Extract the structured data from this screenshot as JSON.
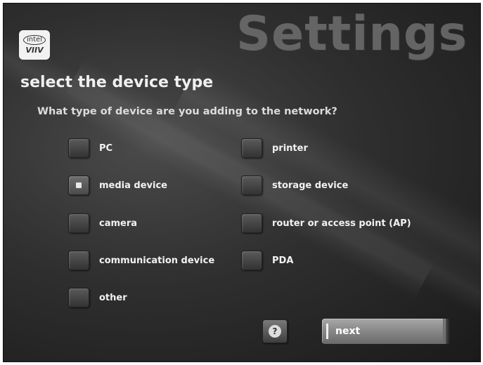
{
  "header": {
    "watermark_title": "Settings",
    "logo": {
      "brand_text": "intel",
      "product_text": "VIIV"
    }
  },
  "main": {
    "title": "select the device type",
    "question": "What type of device are you adding to the network?",
    "options_left": [
      {
        "label": "PC",
        "checked": false
      },
      {
        "label": "media device",
        "checked": true
      },
      {
        "label": "camera",
        "checked": false
      },
      {
        "label": "communication device",
        "checked": false
      },
      {
        "label": "other",
        "checked": false
      }
    ],
    "options_right": [
      {
        "label": "printer",
        "checked": false
      },
      {
        "label": "storage device",
        "checked": false
      },
      {
        "label": "router or access point (AP)",
        "checked": false
      },
      {
        "label": "PDA",
        "checked": false
      }
    ]
  },
  "footer": {
    "help_icon_glyph": "?",
    "next_label": "next"
  },
  "colors": {
    "background": "#2f2f2f",
    "text": "#f2f2f2",
    "button": "#8a8a8a"
  }
}
